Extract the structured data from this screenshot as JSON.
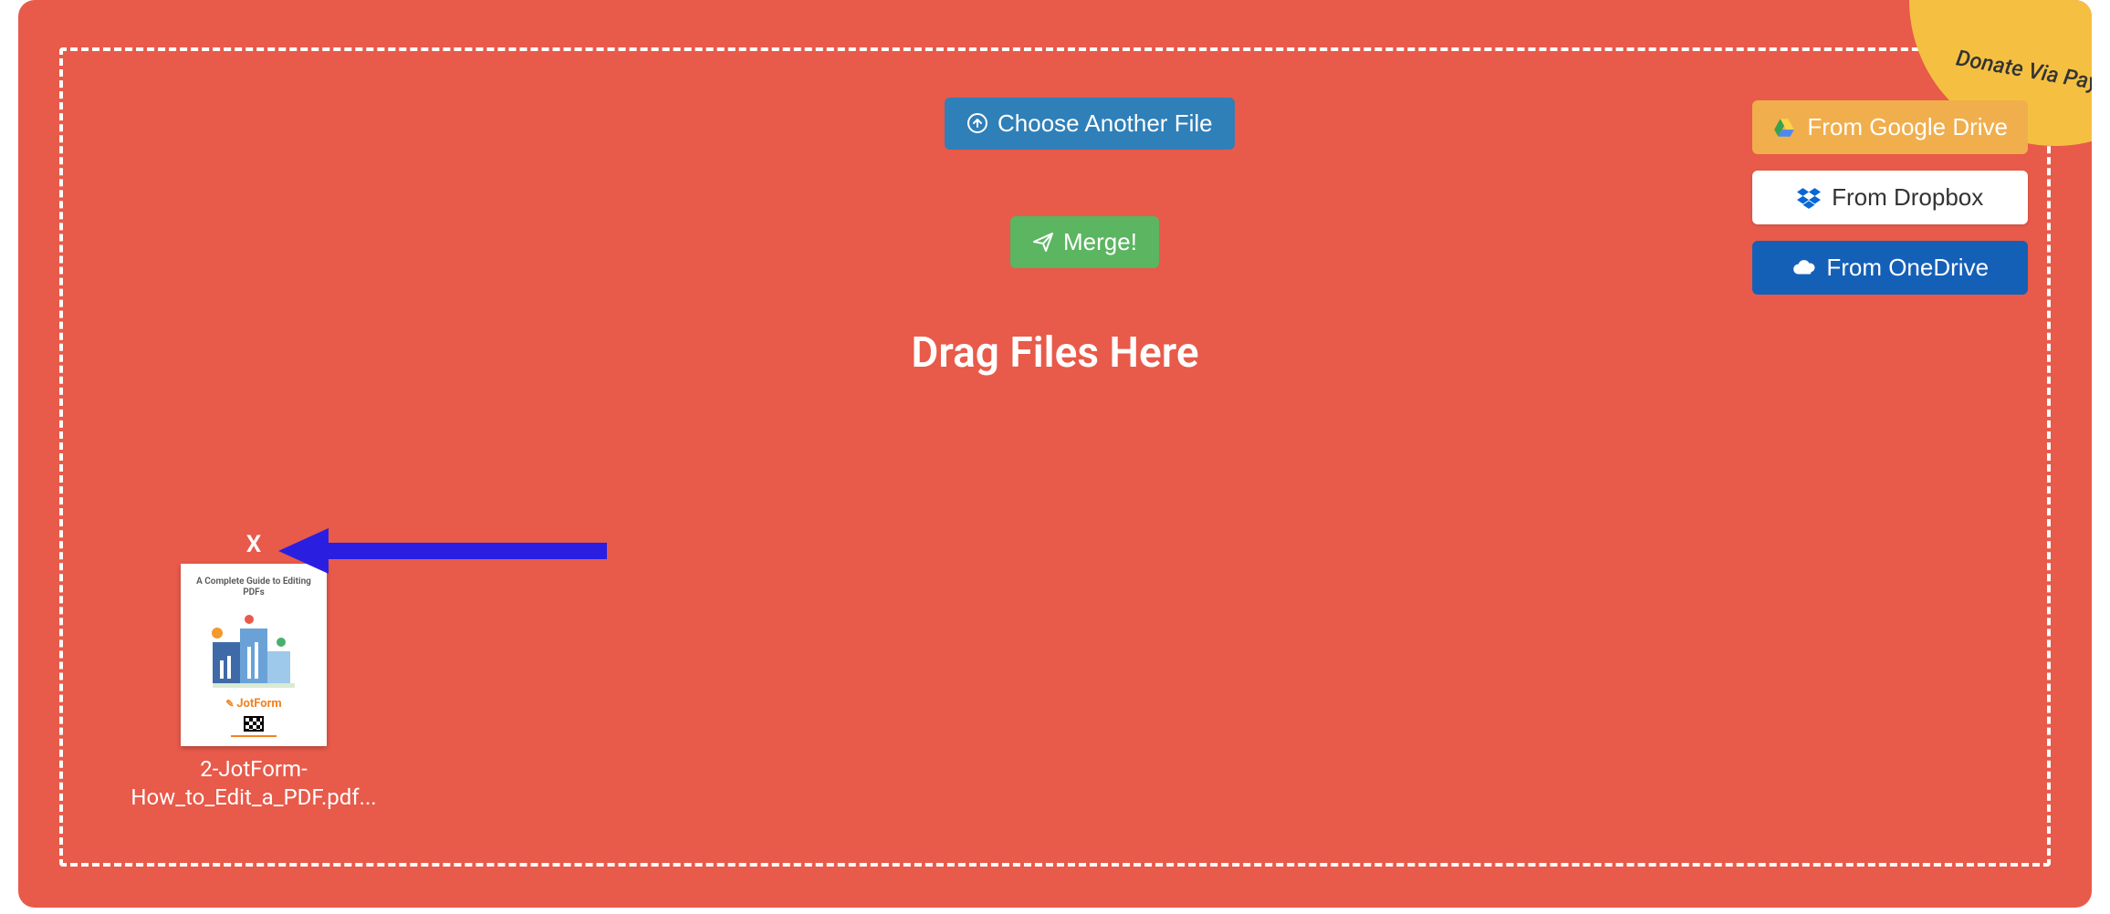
{
  "donate": {
    "label": "Donate Via PayPal"
  },
  "buttons": {
    "choose_label": "Choose Another File",
    "merge_label": "Merge!"
  },
  "heading": "Drag Files Here",
  "cloud": {
    "gdrive_label": "From Google Drive",
    "dropbox_label": "From Dropbox",
    "onedrive_label": "From OneDrive"
  },
  "file": {
    "remove_label": "X",
    "thumb_title": "A Complete Guide to Editing PDFs",
    "thumb_brand": "JotForm",
    "name_line1": "2-JotForm-",
    "name_line2": "How_to_Edit_a_PDF.pdf..."
  }
}
